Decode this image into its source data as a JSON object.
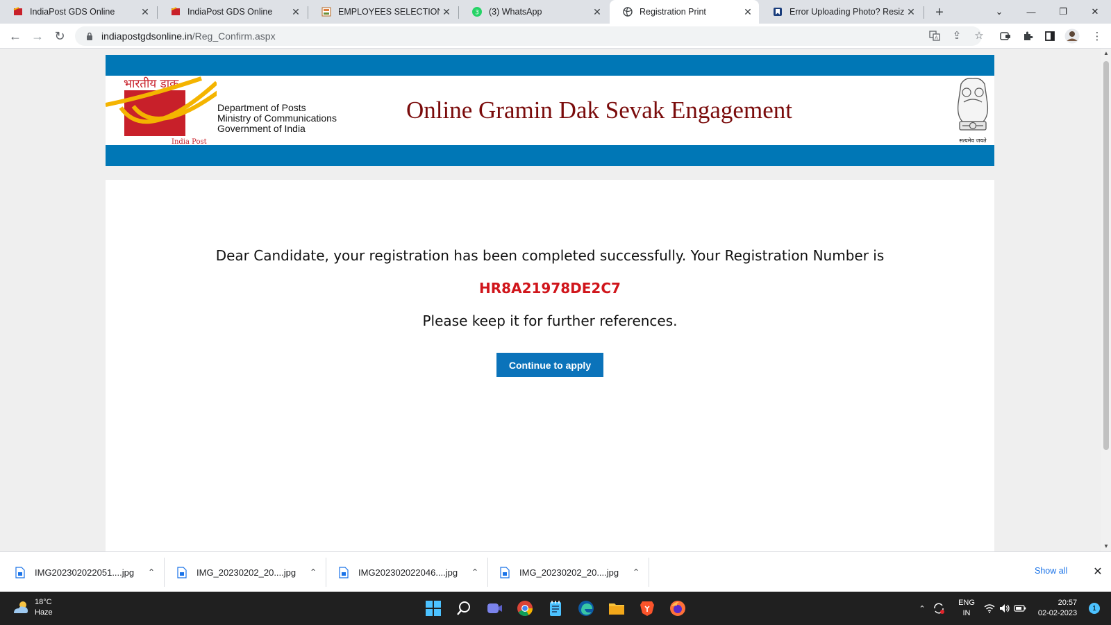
{
  "browser": {
    "tabs": [
      {
        "title": "IndiaPost GDS Online",
        "favicon": "indiapost-icon",
        "active": false
      },
      {
        "title": "IndiaPost GDS Online",
        "favicon": "indiapost-icon",
        "active": false
      },
      {
        "title": "EMPLOYEES SELECTION BOAR",
        "favicon": "esb-icon",
        "active": false
      },
      {
        "title": "(3) WhatsApp",
        "favicon": "whatsapp-icon",
        "active": false
      },
      {
        "title": "Registration Print",
        "favicon": "globe-icon",
        "active": true
      },
      {
        "title": "Error Uploading Photo? Resiz",
        "favicon": "bookmark-icon",
        "active": false
      }
    ],
    "address": {
      "host": "indiapostgdsonline.in",
      "path": "/Reg_Confirm.aspx"
    }
  },
  "page": {
    "header": {
      "hindi_brand": "भारतीय डाक",
      "india_post": "India Post",
      "dept_line1": "Department of Posts",
      "dept_line2": "Ministry of Communications",
      "dept_line3": "Government of India",
      "title": "Online Gramin Dak Sevak Engagement",
      "emblem_motto": "सत्यमेव जयते"
    },
    "confirmation": {
      "message": "Dear Candidate, your registration has been completed successfully. Your Registration Number is",
      "registration_number": "HR8A21978DE2C7",
      "note": "Please keep it for further references.",
      "button": "Continue to apply"
    },
    "colors": {
      "band": "#0077b6",
      "title": "#7a0b0b",
      "regno": "#d0151b",
      "button": "#0b73ba"
    }
  },
  "downloads": {
    "items": [
      {
        "name": "IMG202302022051....jpg"
      },
      {
        "name": "IMG_20230202_20....jpg"
      },
      {
        "name": "IMG202302022046....jpg"
      },
      {
        "name": "IMG_20230202_20....jpg"
      }
    ],
    "show_all": "Show all"
  },
  "taskbar": {
    "weather": {
      "temp": "18°C",
      "condition": "Haze"
    },
    "lang_line1": "ENG",
    "lang_line2": "IN",
    "time": "20:57",
    "date": "02-02-2023",
    "notification_count": "1"
  }
}
